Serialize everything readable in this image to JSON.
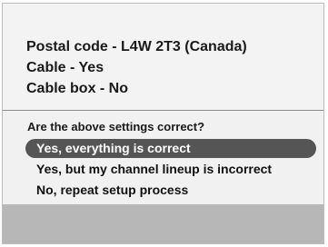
{
  "settings_summary": {
    "postal_code": "Postal code - L4W 2T3 (Canada)",
    "cable": "Cable - Yes",
    "cable_box": "Cable box - No"
  },
  "prompt": {
    "question": "Are the above settings correct?"
  },
  "options": [
    {
      "label": "Yes, everything is correct",
      "selected": true
    },
    {
      "label": "Yes, but my channel lineup is incorrect",
      "selected": false
    },
    {
      "label": "No, repeat setup process",
      "selected": false
    }
  ],
  "colors": {
    "highlight": "#555555",
    "highlight_text": "#ffffff",
    "bottom_band": "#b7b7b7"
  }
}
